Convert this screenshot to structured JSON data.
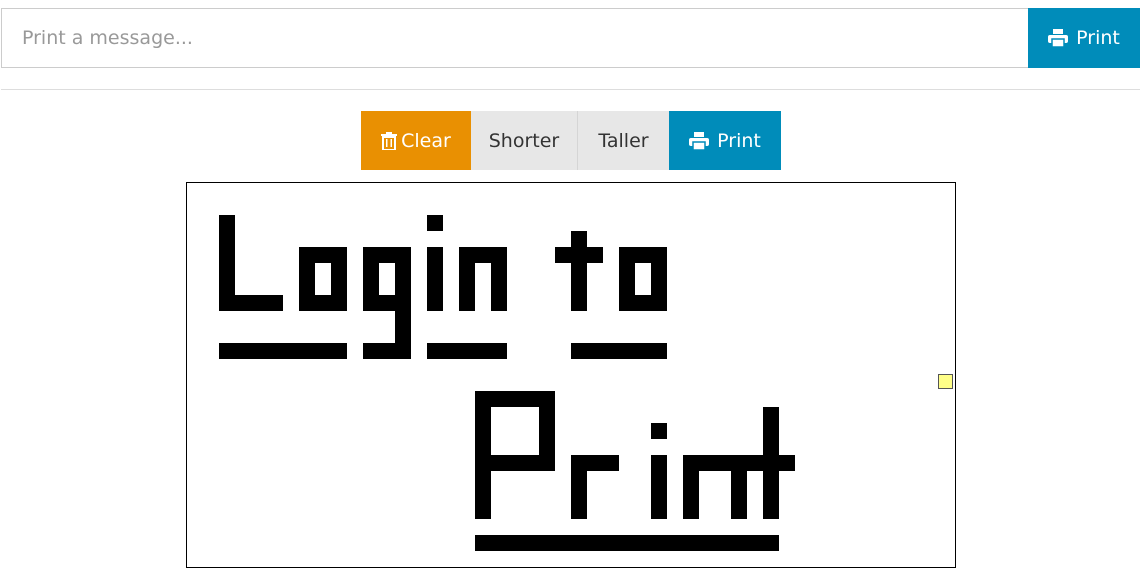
{
  "message_input": {
    "placeholder": "Print a message...",
    "value": ""
  },
  "top_print_button": {
    "label": "Print",
    "icon": "printer-icon"
  },
  "toolbar": {
    "clear": {
      "label": "Clear",
      "icon": "trash-icon",
      "color": "#e99002"
    },
    "shorter": {
      "label": "Shorter"
    },
    "taller": {
      "label": "Taller"
    },
    "print": {
      "label": "Print",
      "icon": "printer-icon",
      "color": "#008cba"
    }
  },
  "preview": {
    "lines": [
      "Login to",
      "Print"
    ]
  }
}
